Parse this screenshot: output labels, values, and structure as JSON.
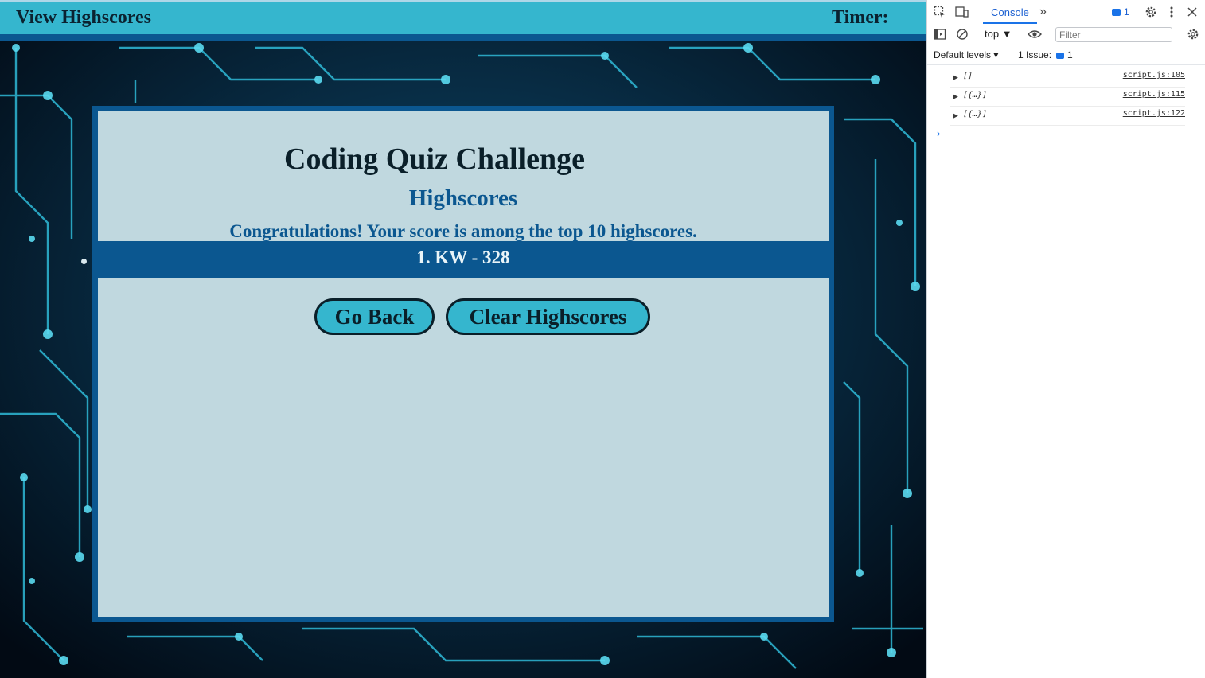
{
  "nav": {
    "view_highscores": "View Highscores",
    "timer_label": "Timer:"
  },
  "card": {
    "title": "Coding Quiz Challenge",
    "subtitle": "Highscores",
    "congrats": "Congratulations! Your score is among the top 10 highscores."
  },
  "scores": [
    {
      "text": "1. KW - 328"
    }
  ],
  "buttons": {
    "go_back": "Go Back",
    "clear_highscores": "Clear Highscores"
  },
  "devtools": {
    "tabs": {
      "active": "Console",
      "more": "»"
    },
    "issues_badge_count": "1",
    "context": "top ▼",
    "filter_placeholder": "Filter",
    "levels": "Default levels ▾",
    "issue_label": "1 Issue:",
    "issue_count": "1",
    "messages": [
      {
        "value": "[]",
        "source": "script.js:105"
      },
      {
        "value": "[{…}]",
        "source": "script.js:115"
      },
      {
        "value": "[{…}]",
        "source": "script.js:122"
      }
    ],
    "prompt": "›"
  },
  "colors": {
    "nav_bar": "#35b6ce",
    "accent_dark_blue": "#0b5790",
    "card_bg": "#deeeec",
    "button_fill": "#35b6ce"
  },
  "icons": {
    "inspect": "inspect-element-icon",
    "device": "device-toolbar-icon",
    "settings": "gear-icon",
    "menu": "kebab-menu-icon",
    "close": "close-icon",
    "sidebar": "sidebar-toggle-icon",
    "clear": "clear-console-icon",
    "eye": "live-expression-eye-icon"
  }
}
